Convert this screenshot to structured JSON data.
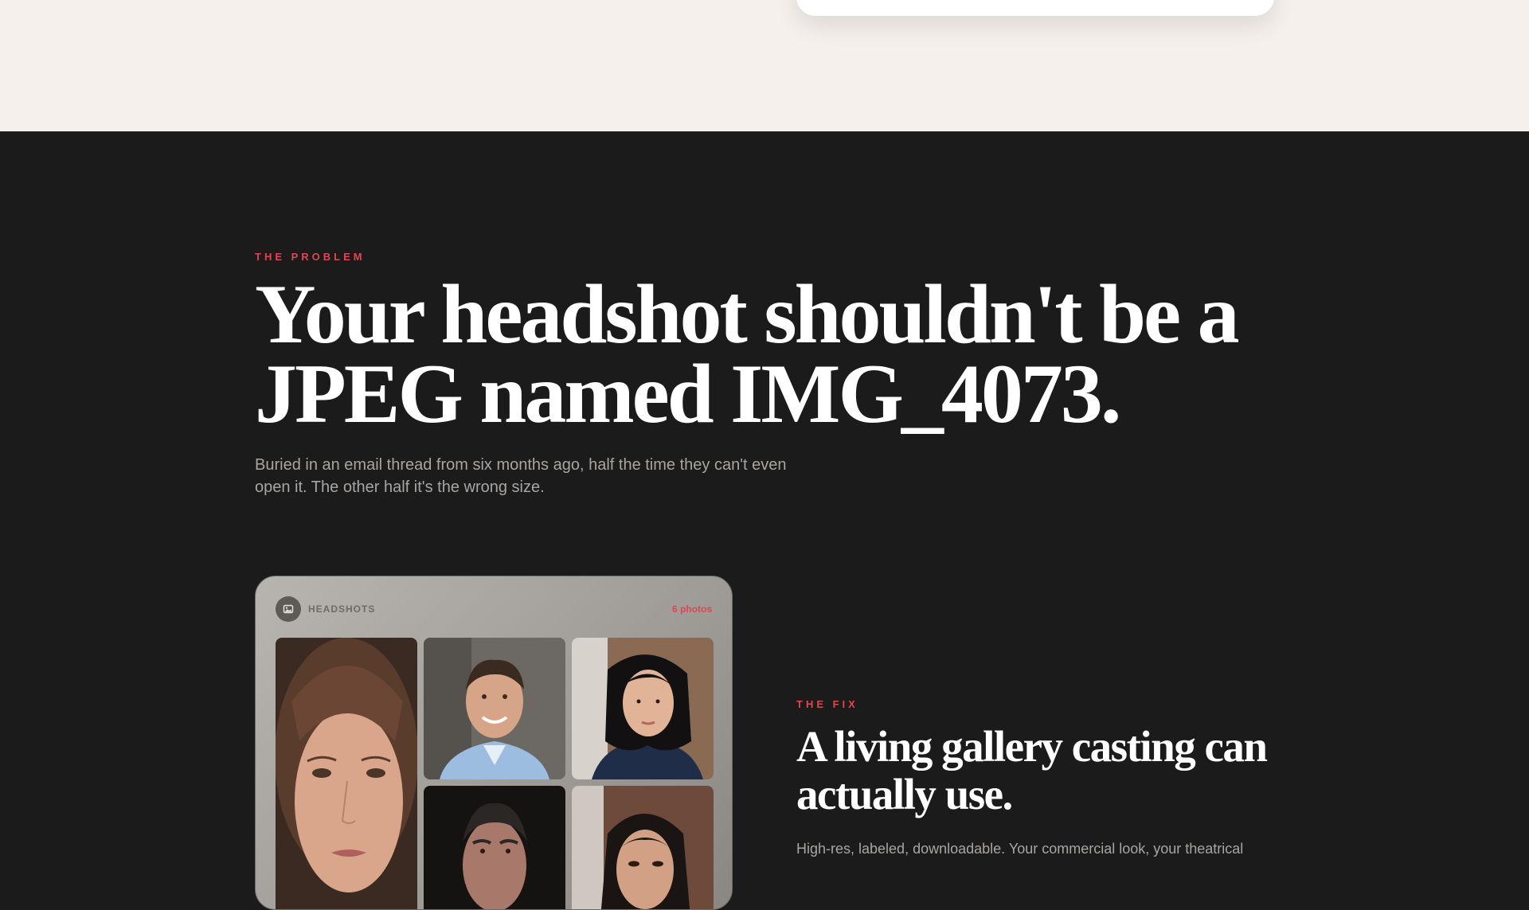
{
  "problem": {
    "eyebrow": "THE PROBLEM",
    "headline": "Your headshot shouldn't be a JPEG named IMG_4073.",
    "body": "Buried in an email thread from six months ago, half the time they can't even open it. The other half it's the wrong size."
  },
  "gallery": {
    "icon": "image-icon",
    "title": "HEADSHOTS",
    "count": "6 photos"
  },
  "fix": {
    "eyebrow": "THE FIX",
    "headline": "A living gallery casting can actually use.",
    "body": "High-res, labeled, downloadable. Your commercial look, your theatrical"
  },
  "colors": {
    "accent": "#e0474c",
    "dark_bg": "#1c1b1b",
    "light_bg": "#f5f0eb"
  }
}
